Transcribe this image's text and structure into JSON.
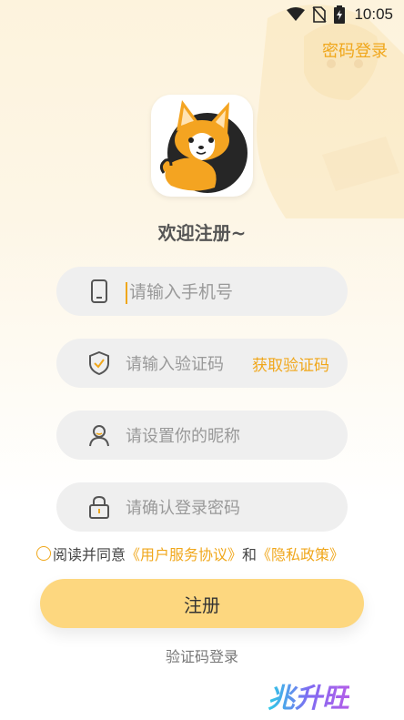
{
  "status_bar": {
    "time": "10:05",
    "icons": [
      "wifi-icon",
      "no-sim-icon",
      "battery-charging-icon"
    ]
  },
  "header": {
    "password_login": "密码登录"
  },
  "welcome": "欢迎注册~",
  "form": {
    "phone": {
      "placeholder": "请输入手机号",
      "icon": "phone-icon"
    },
    "code": {
      "placeholder": "请输入验证码",
      "icon": "shield-check-icon",
      "get_code": "获取验证码"
    },
    "nickname": {
      "placeholder": "请设置你的昵称",
      "icon": "user-icon"
    },
    "password": {
      "placeholder": "请确认登录密码",
      "icon": "lock-icon"
    }
  },
  "agreement": {
    "prefix": "阅读并同意",
    "user_agreement": "《用户服务协议》",
    "and": "和",
    "privacy_policy": "《隐私政策》"
  },
  "register_button": "注册",
  "code_login": "验证码登录",
  "watermark": "兆升旺",
  "colors": {
    "accent": "#f0a71b",
    "button": "#fdd77f",
    "field_bg": "#efefef"
  }
}
